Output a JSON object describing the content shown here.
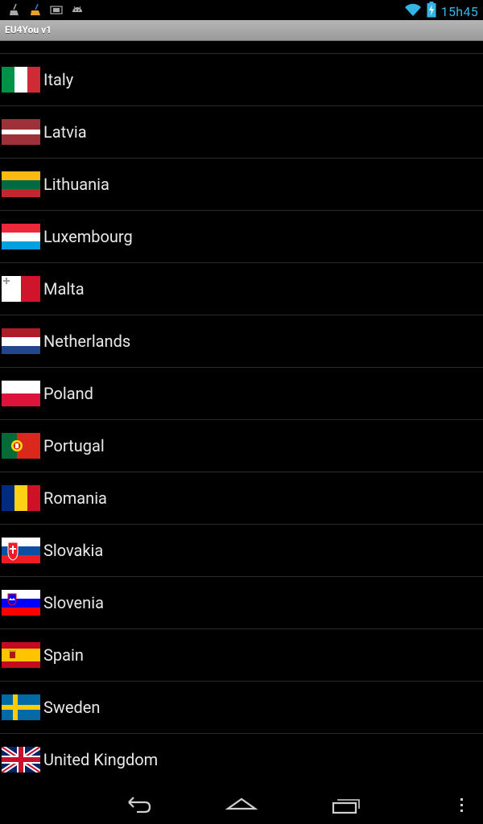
{
  "status_bar": {
    "time": "15h45",
    "left_icons": [
      "broom-icon",
      "broom-color-icon",
      "screenshot-icon",
      "android-icon"
    ],
    "right_icons": [
      "wifi-icon",
      "battery-charging-icon"
    ]
  },
  "app": {
    "title": "EU4You v1"
  },
  "countries": [
    {
      "name": "Italy",
      "flag": "italy-flag-icon"
    },
    {
      "name": "Latvia",
      "flag": "latvia-flag-icon"
    },
    {
      "name": "Lithuania",
      "flag": "lithuania-flag-icon"
    },
    {
      "name": "Luxembourg",
      "flag": "luxembourg-flag-icon"
    },
    {
      "name": "Malta",
      "flag": "malta-flag-icon"
    },
    {
      "name": "Netherlands",
      "flag": "netherlands-flag-icon"
    },
    {
      "name": "Poland",
      "flag": "poland-flag-icon"
    },
    {
      "name": "Portugal",
      "flag": "portugal-flag-icon"
    },
    {
      "name": "Romania",
      "flag": "romania-flag-icon"
    },
    {
      "name": "Slovakia",
      "flag": "slovakia-flag-icon"
    },
    {
      "name": "Slovenia",
      "flag": "slovenia-flag-icon"
    },
    {
      "name": "Spain",
      "flag": "spain-flag-icon"
    },
    {
      "name": "Sweden",
      "flag": "sweden-flag-icon"
    },
    {
      "name": "United Kingdom",
      "flag": "uk-flag-icon"
    }
  ],
  "nav_bar": {
    "buttons": [
      "back-icon",
      "home-icon",
      "recent-apps-icon",
      "overflow-menu-icon"
    ]
  },
  "colors": {
    "background": "#000000",
    "text": "#e8e8e8",
    "clock": "#33b5e5",
    "titlebar": "#a8a8a8",
    "divider": "#2a2a2a"
  }
}
